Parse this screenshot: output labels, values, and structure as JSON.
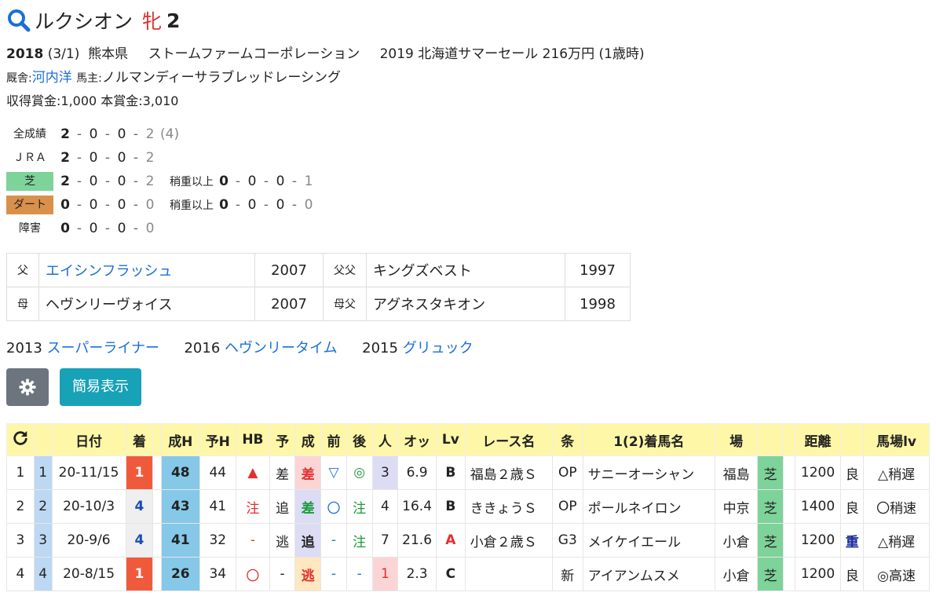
{
  "header": {
    "name": "ルクシオン",
    "sex": "牝",
    "age": "2"
  },
  "profile": {
    "year": "2018",
    "birthdate": "(3/1)",
    "region": "熊本県",
    "breeder": "ストームファームコーポレーション",
    "sale": "2019 北海道サマーセール 216万円 (1歳時)",
    "stable_label": "厩舎:",
    "trainer": "河内洋",
    "owner_label": "馬主:",
    "owner": "ノルマンディーサラブレッドレーシング",
    "earnings": "収得賞金:1,000 本賞金:3,010"
  },
  "record": {
    "overall": {
      "label": "全成績",
      "v": [
        "2",
        "0",
        "0",
        "2"
      ],
      "extra": "(4)"
    },
    "jra": {
      "label": "ＪＲＡ",
      "v": [
        "2",
        "0",
        "0",
        "2"
      ]
    },
    "turf": {
      "label": "芝",
      "v": [
        "2",
        "0",
        "0",
        "2"
      ],
      "sub_label": "稍重以上",
      "sub": [
        "0",
        "0",
        "0",
        "1"
      ]
    },
    "dirt": {
      "label": "ダート",
      "v": [
        "0",
        "0",
        "0",
        "0"
      ],
      "sub_label": "稍重以上",
      "sub": [
        "0",
        "0",
        "0",
        "0"
      ]
    },
    "steeple": {
      "label": "障害",
      "v": [
        "0",
        "0",
        "0",
        "0"
      ]
    }
  },
  "pedigree": {
    "rows": [
      {
        "l1": "父",
        "n1": "エイシンフラッシュ",
        "y1": "2007",
        "l2": "父父",
        "n2": "キングズベスト",
        "y2": "1997"
      },
      {
        "l1": "母",
        "n1": "ヘヴンリーヴォイス",
        "y1": "2007",
        "l2": "母父",
        "n2": "アグネスタキオン",
        "y2": "1998"
      }
    ]
  },
  "siblings": [
    {
      "year": "2013",
      "name": "スーパーライナー"
    },
    {
      "year": "2016",
      "name": "ヘヴンリータイム"
    },
    {
      "year": "2015",
      "name": "グリュック"
    }
  ],
  "buttons": {
    "gear": "gear-icon",
    "simple": "簡易表示"
  },
  "races": {
    "headers": [
      "",
      "",
      "日付",
      "着",
      "",
      "成H",
      "予H",
      "HB",
      "予",
      "成",
      "前",
      "後",
      "人",
      "オッ",
      "Lv",
      "レース名",
      "条",
      "1(2)着馬名",
      "場",
      "",
      "",
      "距離",
      "",
      "馬場lv"
    ],
    "rows": [
      [
        "1",
        "1",
        "20-11/15",
        "1",
        "",
        "48",
        "44",
        "▲",
        "差",
        "差",
        "▽",
        "◎",
        "3",
        "6.9",
        "B",
        "福島２歳Ｓ",
        "OP",
        "サニーオーシャン",
        "福島",
        "芝",
        "",
        "1200",
        "良",
        "△稍遅"
      ],
      [
        "2",
        "2",
        "20-10/3",
        "4",
        "",
        "43",
        "41",
        "注",
        "追",
        "差",
        "〇",
        "注",
        "4",
        "16.4",
        "B",
        "ききょうＳ",
        "OP",
        "ポールネイロン",
        "中京",
        "芝",
        "",
        "1400",
        "良",
        "〇稍速"
      ],
      [
        "3",
        "3",
        "20-9/6",
        "4",
        "",
        "41",
        "32",
        "-",
        "逃",
        "追",
        "-",
        "注",
        "7",
        "21.6",
        "A",
        "小倉２歳Ｓ",
        "G3",
        "メイケイエール",
        "小倉",
        "芝",
        "",
        "1200",
        "重",
        "△稍遅"
      ],
      [
        "4",
        "4",
        "20-8/15",
        "1",
        "",
        "26",
        "34",
        "〇",
        "-",
        "逃",
        "-",
        "-",
        "1",
        "2.3",
        "C",
        "",
        "新",
        "アイアンムスメ",
        "小倉",
        "芝",
        "",
        "1200",
        "良",
        "◎高速"
      ]
    ]
  },
  "colors": {
    "accent": "#1a6fd8",
    "header_bg": "#fff7a8",
    "turf": "#7dd39a",
    "dirt": "#d9904b",
    "win": "#f05a3c"
  }
}
